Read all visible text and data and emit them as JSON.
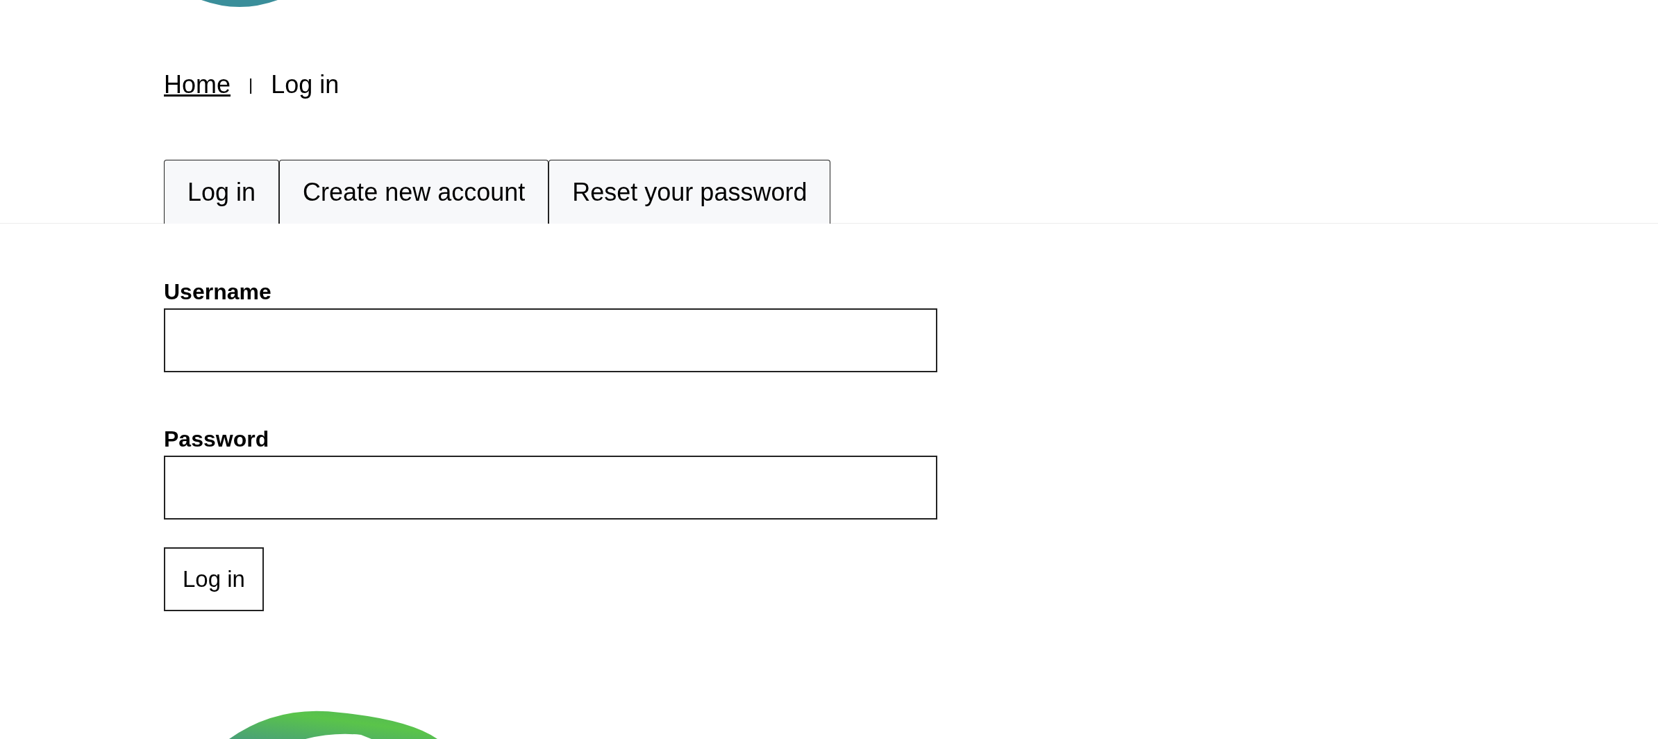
{
  "breadcrumb": {
    "items": [
      "Home",
      "Log in"
    ],
    "separator": "|"
  },
  "tabs": [
    {
      "label": "Log in"
    },
    {
      "label": "Create new account"
    },
    {
      "label": "Reset your password"
    }
  ],
  "form": {
    "fields": [
      {
        "label": "Username"
      },
      {
        "label": "Password"
      }
    ],
    "submit": "Log in"
  }
}
